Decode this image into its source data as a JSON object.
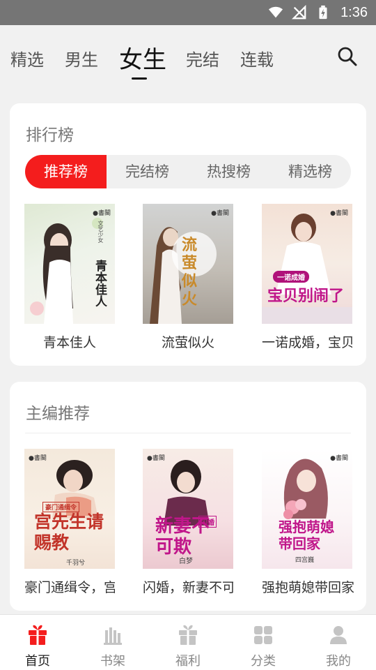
{
  "status_bar": {
    "time": "1:36"
  },
  "top_nav": {
    "tabs": [
      {
        "label": "精选"
      },
      {
        "label": "男生"
      },
      {
        "label": "女生"
      },
      {
        "label": "完结"
      },
      {
        "label": "连载"
      }
    ],
    "active_tab": "女生",
    "search_icon": "search-icon"
  },
  "ranking": {
    "title": "排行榜",
    "segments": [
      {
        "label": "推荐榜"
      },
      {
        "label": "完结榜"
      },
      {
        "label": "热搜榜"
      },
      {
        "label": "精选榜"
      }
    ],
    "active_segment": "推荐榜",
    "books": [
      {
        "title": "青本佳人",
        "cover_text": "青本佳人",
        "cover_sub": "文艺少女"
      },
      {
        "title": "流萤似火",
        "cover_text": "流萤似火",
        "cover_sub": ""
      },
      {
        "title": "一诺成婚，宝贝别闹了",
        "cover_text": "宝贝别闹了",
        "cover_sub": "一诺成婚"
      }
    ]
  },
  "editor_pick": {
    "title": "主编推荐",
    "books": [
      {
        "title": "豪门通缉令，宫先生请赐教",
        "cover_text": "宫先生请赐教",
        "cover_sub": "豪门通缉令",
        "author": "千羽兮"
      },
      {
        "title": "闪婚，新妻不可欺",
        "cover_text": "新妻不可欺",
        "cover_sub": "闪婚",
        "author": "白梦"
      },
      {
        "title": "强抱萌媳带回家",
        "cover_text": "强抱萌媳带回家",
        "cover_sub": "",
        "author": "四宫巍"
      }
    ]
  },
  "bottom_nav": {
    "items": [
      {
        "label": "首页",
        "icon": "gift-icon"
      },
      {
        "label": "书架",
        "icon": "bookshelf-icon"
      },
      {
        "label": "福利",
        "icon": "gift-box-icon"
      },
      {
        "label": "分类",
        "icon": "grid-icon"
      },
      {
        "label": "我的",
        "icon": "user-icon"
      }
    ],
    "active_item": "首页"
  },
  "colors": {
    "accent": "#f41d1d",
    "active_text": "#222222",
    "muted_text": "#888888"
  }
}
